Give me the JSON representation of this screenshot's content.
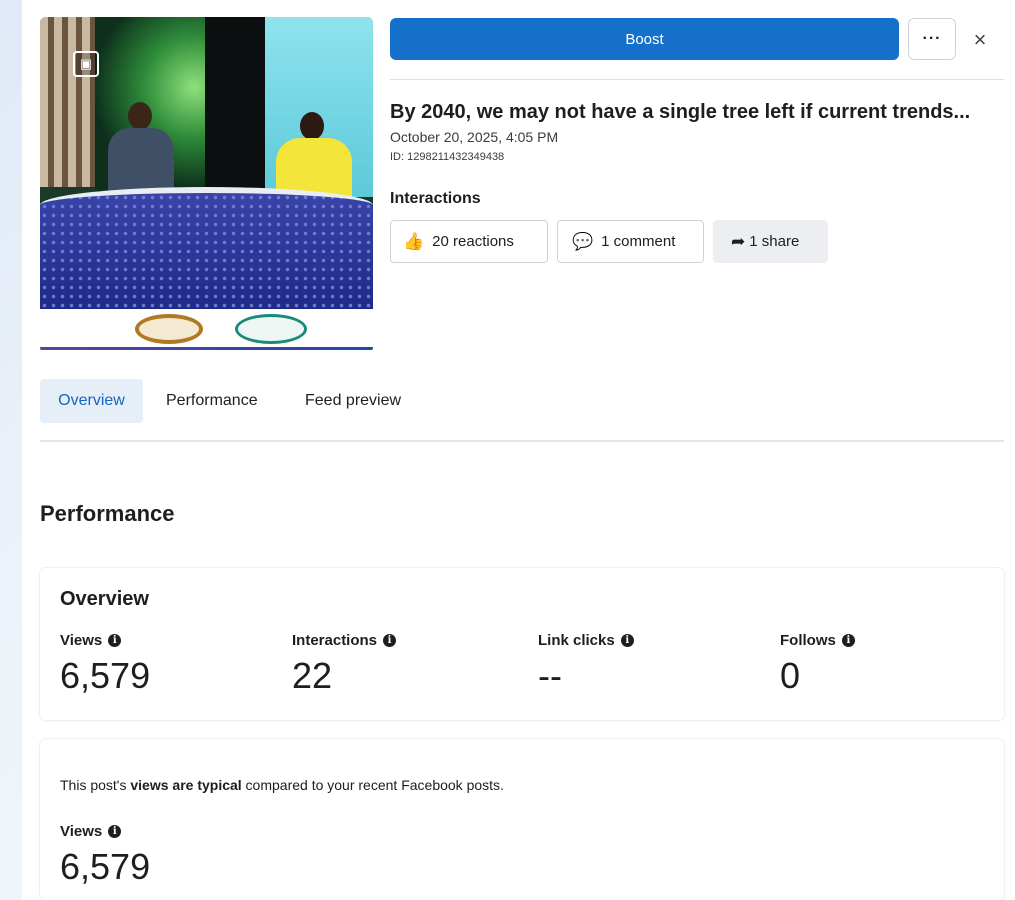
{
  "header": {
    "boost_label": "Boost",
    "more_label": "···",
    "close_label": "×"
  },
  "post": {
    "title": "By 2040, we may not have a single tree left if current trends...",
    "date": "October 20, 2025, 4:05 PM",
    "id": "ID: 1298211432349438",
    "gallery_icon": "gallery-icon"
  },
  "interactions": {
    "label": "Interactions",
    "reactions": {
      "icon": "thumbs-up-icon",
      "label": "20 reactions"
    },
    "comment": {
      "icon": "comment-icon",
      "label": "1 comment"
    },
    "share": {
      "icon": "share-icon",
      "label": "1 share"
    }
  },
  "tabs": [
    {
      "label": "Overview",
      "active": true
    },
    {
      "label": "Performance",
      "active": false
    },
    {
      "label": "Feed preview",
      "active": false
    }
  ],
  "performance": {
    "section_title": "Performance",
    "overview_title": "Overview",
    "metrics": [
      {
        "label": "Views",
        "value": "6,579"
      },
      {
        "label": "Interactions",
        "value": "22"
      },
      {
        "label": "Link clicks",
        "value": "--"
      },
      {
        "label": "Follows",
        "value": "0"
      }
    ],
    "typical_prefix": "This post's ",
    "typical_bold": "views are typical",
    "typical_suffix": " compared to your recent Facebook posts.",
    "views_label": "Views",
    "views_value": "6,579"
  },
  "colors": {
    "accent": "#1470c8",
    "active_tab_bg": "#e6eef8",
    "active_tab_text": "#1466c0"
  }
}
